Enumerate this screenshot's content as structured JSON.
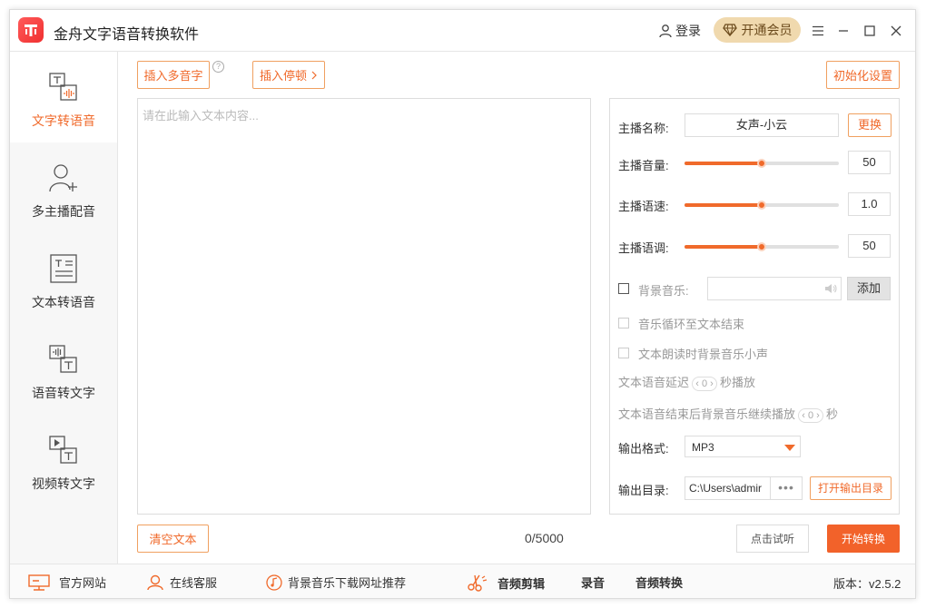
{
  "app": {
    "title": "金舟文字语音转换软件",
    "login_label": "登录",
    "vip_label": "开通会员"
  },
  "sidebar": {
    "items": [
      {
        "label": "文字转语音",
        "icon": "text-to-speech-icon",
        "active": true
      },
      {
        "label": "多主播配音",
        "icon": "add-user-icon",
        "active": false
      },
      {
        "label": "文本转语音",
        "icon": "document-icon",
        "active": false
      },
      {
        "label": "语音转文字",
        "icon": "speech-to-text-icon",
        "active": false
      },
      {
        "label": "视频转文字",
        "icon": "video-to-text-icon",
        "active": false
      }
    ]
  },
  "toolbar": {
    "insert_polyphone": "插入多音字",
    "help": "?",
    "insert_pause": "插入停顿",
    "init_settings": "初始化设置"
  },
  "editor": {
    "placeholder": "请在此输入文本内容...",
    "char_count": "0/5000",
    "clear_label": "清空文本"
  },
  "settings": {
    "anchor_label": "主播名称:",
    "anchor_value": "女声-小云",
    "change_label": "更换",
    "volume_label": "主播音量:",
    "volume_value": "50",
    "volume_fraction": 0.5,
    "speed_label": "主播语速:",
    "speed_value": "1.0",
    "speed_fraction": 0.5,
    "pitch_label": "主播语调:",
    "pitch_value": "50",
    "pitch_fraction": 0.5,
    "bgm_label": "背景音乐:",
    "bgm_add": "添加",
    "loop_label": "音乐循环至文本结束",
    "duck_label": "文本朗读时背景音乐小声",
    "delay_prefix": "文本语音延迟",
    "delay_value": "0",
    "delay_suffix": "秒播放",
    "continue_prefix": "文本语音结束后背景音乐继续播放",
    "continue_value": "0",
    "continue_suffix": "秒",
    "format_label": "输出格式:",
    "format_value": "MP3",
    "dir_label": "输出目录:",
    "dir_value": "C:\\Users\\admir",
    "dir_dots": "•••",
    "open_dir": "打开输出目录"
  },
  "actions": {
    "preview": "点击试听",
    "start": "开始转换"
  },
  "footer": {
    "website": "官方网站",
    "service": "在线客服",
    "bgm_download": "背景音乐下载网址推荐",
    "audio_edit": "音频剪辑",
    "record": "录音",
    "audio_convert": "音频转换",
    "version": "版本：v2.5.2"
  },
  "colors": {
    "accent": "#f06a2b",
    "primary_btn": "#f2622a",
    "vip_bg": "#f0d9ae"
  }
}
